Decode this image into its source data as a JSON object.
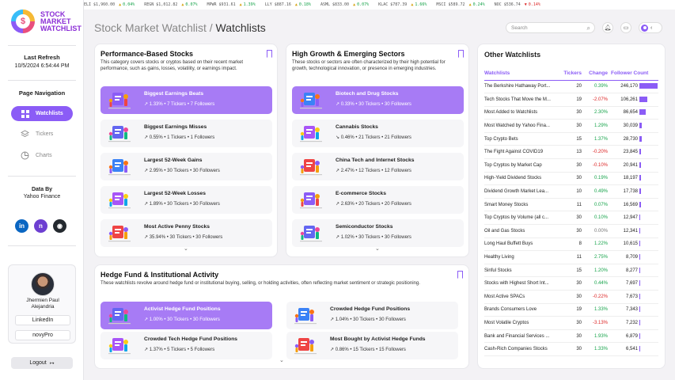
{
  "app": {
    "logo_line1": "STOCK",
    "logo_line2": "MARKET",
    "logo_line3": "WATCHLIST",
    "logo_symbol": "$"
  },
  "sidebar": {
    "last_refresh_label": "Last Refresh",
    "last_refresh_value": "10/5/2024 6:54:44 PM",
    "nav_title": "Page Navigation",
    "nav": [
      {
        "label": "Watchlists",
        "icon": "grid-icon",
        "active": true
      },
      {
        "label": "Tickers",
        "icon": "layers-icon",
        "active": false
      },
      {
        "label": "Charts",
        "icon": "pie-chart-icon",
        "active": false
      }
    ],
    "data_by_label": "Data By",
    "data_by_value": "Yahoo Finance",
    "socials": [
      {
        "icon": "linkedin-icon",
        "glyph": "in",
        "color": "#0a66c2"
      },
      {
        "icon": "novypro-icon",
        "glyph": "n",
        "color": "#6d3fd1"
      },
      {
        "icon": "github-icon",
        "glyph": "◉",
        "color": "#24292f"
      }
    ],
    "profile_name_line1": "Jhermien Paul",
    "profile_name_line2": "Alejandria",
    "profile_btn1": "LinkedIn",
    "profile_btn2": "novyPro",
    "logout": "Logout",
    "logout_icon": "↦"
  },
  "ticker_tape": [
    {
      "sym": "ELI",
      "price": "$1,960.00",
      "chg": "0.04%",
      "dir": "up"
    },
    {
      "sym": "REGN",
      "price": "$1,012.82",
      "chg": "0.07%",
      "dir": "up"
    },
    {
      "sym": "MPWR",
      "price": "$931.61",
      "chg": "1.39%",
      "dir": "up"
    },
    {
      "sym": "LLY",
      "price": "$887.16",
      "chg": "0.18%",
      "dir": "up"
    },
    {
      "sym": "ASML",
      "price": "$833.00",
      "chg": "0.07%",
      "dir": "up"
    },
    {
      "sym": "KLAC",
      "price": "$787.39",
      "chg": "1.66%",
      "dir": "up"
    },
    {
      "sym": "MSCI",
      "price": "$589.72",
      "chg": "0.24%",
      "dir": "up"
    },
    {
      "sym": "NOC",
      "price": "$536.74",
      "chg": "0.14%",
      "dir": "down"
    }
  ],
  "header": {
    "title_prefix": "Stock Market Watchlist / ",
    "title_main": "Watchlists",
    "search_placeholder": "Search",
    "search_icon": "⌕",
    "bell_icon": "♫",
    "chat_icon": "▭",
    "chevron_icon": "‹"
  },
  "performance": {
    "title": "Performance-Based Stocks",
    "desc": "This category covers stocks or cryptos based on their recent market performance, such as gains, losses, volatility, or earnings impact.",
    "items": [
      {
        "name": "Biggest Earnings Beats",
        "stats": "↗ 1.33% • 7 Tickers • 7 Followers",
        "active": true
      },
      {
        "name": "Biggest Earnings Misses",
        "stats": "↗ 0.55% • 1 Tickers • 1 Followers",
        "active": false
      },
      {
        "name": "Largest 52-Week Gains",
        "stats": "↗ 2.95% • 30 Tickers • 30 Followers",
        "active": false
      },
      {
        "name": "Largest 52-Week Losses",
        "stats": "↗ 1.89% • 30 Tickers • 30 Followers",
        "active": false
      },
      {
        "name": "Most Active Penny Stocks",
        "stats": "↗ 35.94% • 30 Tickers • 30 Followers",
        "active": false
      }
    ]
  },
  "growth": {
    "title": "High Growth & Emerging Sectors",
    "desc": "These stocks or sectors are often characterized by their high potential for growth, technological innovation, or presence in emerging industries.",
    "items": [
      {
        "name": "Biotech and Drug Stocks",
        "stats": "↗ 0.33% • 30 Tickers • 30 Followers",
        "active": true
      },
      {
        "name": "Cannabis Stocks",
        "stats": "↘ 0.46% • 21 Tickers • 21 Followers",
        "active": false
      },
      {
        "name": "China Tech and Internet Stocks",
        "stats": "↗ 2.47% • 12 Tickers • 12 Followers",
        "active": false
      },
      {
        "name": "E-commerce Stocks",
        "stats": "↗ 2.63% • 20 Tickers • 20 Followers",
        "active": false
      },
      {
        "name": "Semiconductor Stocks",
        "stats": "↗ 1.02% • 30 Tickers • 30 Followers",
        "active": false
      }
    ]
  },
  "hedge": {
    "title": "Hedge Fund & Institutional Activity",
    "desc": "These watchlists revolve around hedge fund or institutional buying, selling, or holding activities, often reflecting market sentiment or strategic positioning.",
    "items": [
      {
        "name": "Activist Hedge Fund Positions",
        "stats": "↗ 1.00% • 30 Tickers • 30 Followers",
        "active": true
      },
      {
        "name": "Crowded Hedge Fund Positions",
        "stats": "↗ 1.04% • 30 Tickers • 30 Followers",
        "active": false
      },
      {
        "name": "Crowded Tech Hedge Fund Positions",
        "stats": "↗ 1.37% • 5 Tickers • 5 Followers",
        "active": false
      },
      {
        "name": "Most Bought by Activist Hedge Funds",
        "stats": "↗ 0.86% • 15 Tickers • 15 Followers",
        "active": false
      }
    ]
  },
  "other": {
    "title": "Other Watchlists",
    "headers": [
      "Watchlists",
      "Tickers",
      "Change",
      "Follower Count"
    ],
    "rows": [
      {
        "name": "The Berkshire Hathaway Port...",
        "tickers": "20",
        "change": "0.39%",
        "dir": "pos",
        "followers": "246,170",
        "bar": 1.0
      },
      {
        "name": "Tech Stocks That Move the M...",
        "tickers": "19",
        "change": "-2.07%",
        "dir": "neg",
        "followers": "106,261",
        "bar": 0.43
      },
      {
        "name": "Most Added to Watchlists",
        "tickers": "30",
        "change": "2.30%",
        "dir": "pos",
        "followers": "86,654",
        "bar": 0.35
      },
      {
        "name": "Most Watched by Yahoo Fina...",
        "tickers": "30",
        "change": "1.29%",
        "dir": "pos",
        "followers": "30,039",
        "bar": 0.12
      },
      {
        "name": "Top Crypto Bets",
        "tickers": "15",
        "change": "1.37%",
        "dir": "pos",
        "followers": "28,730",
        "bar": 0.117
      },
      {
        "name": "The Fight Against COVID19",
        "tickers": "13",
        "change": "-0.20%",
        "dir": "neg",
        "followers": "23,845",
        "bar": 0.097
      },
      {
        "name": "Top Cryptos by Market Cap",
        "tickers": "30",
        "change": "-0.10%",
        "dir": "neg",
        "followers": "20,941",
        "bar": 0.085
      },
      {
        "name": "High-Yield Dividend Stocks",
        "tickers": "30",
        "change": "0.19%",
        "dir": "pos",
        "followers": "18,197",
        "bar": 0.074
      },
      {
        "name": "Dividend Growth Market Lea...",
        "tickers": "10",
        "change": "0.49%",
        "dir": "pos",
        "followers": "17,738",
        "bar": 0.072
      },
      {
        "name": "Smart Money Stocks",
        "tickers": "11",
        "change": "0.07%",
        "dir": "pos",
        "followers": "16,569",
        "bar": 0.067
      },
      {
        "name": "Top Cryptos by Volume (all c...",
        "tickers": "30",
        "change": "0.10%",
        "dir": "pos",
        "followers": "12,947",
        "bar": 0.053
      },
      {
        "name": "Oil and Gas Stocks",
        "tickers": "30",
        "change": "0.00%",
        "dir": "zero",
        "followers": "12,341",
        "bar": 0.05
      },
      {
        "name": "Long Haul Buffett Buys",
        "tickers": "8",
        "change": "1.22%",
        "dir": "pos",
        "followers": "10,615",
        "bar": 0.043
      },
      {
        "name": "Healthy Living",
        "tickers": "11",
        "change": "2.75%",
        "dir": "pos",
        "followers": "8,709",
        "bar": 0.035
      },
      {
        "name": "Sinful Stocks",
        "tickers": "15",
        "change": "1.20%",
        "dir": "pos",
        "followers": "8,277",
        "bar": 0.034
      },
      {
        "name": "Stocks with Highest Short Int...",
        "tickers": "30",
        "change": "0.44%",
        "dir": "pos",
        "followers": "7,697",
        "bar": 0.031
      },
      {
        "name": "Most Active SPACs",
        "tickers": "30",
        "change": "-0.22%",
        "dir": "neg",
        "followers": "7,673",
        "bar": 0.031
      },
      {
        "name": "Brands Consumers Love",
        "tickers": "19",
        "change": "1.33%",
        "dir": "pos",
        "followers": "7,343",
        "bar": 0.03
      },
      {
        "name": "Most Volatile Cryptos",
        "tickers": "30",
        "change": "-3.13%",
        "dir": "neg",
        "followers": "7,232",
        "bar": 0.029
      },
      {
        "name": "Bank and Financial Services ...",
        "tickers": "30",
        "change": "1.93%",
        "dir": "pos",
        "followers": "6,879",
        "bar": 0.028
      },
      {
        "name": "Cash-Rich Companies Stocks",
        "tickers": "30",
        "change": "1.33%",
        "dir": "pos",
        "followers": "6,541",
        "bar": 0.027
      }
    ]
  },
  "colors": {
    "accent": "#8b5cf6",
    "positive": "#16a34a",
    "negative": "#dc2626"
  }
}
